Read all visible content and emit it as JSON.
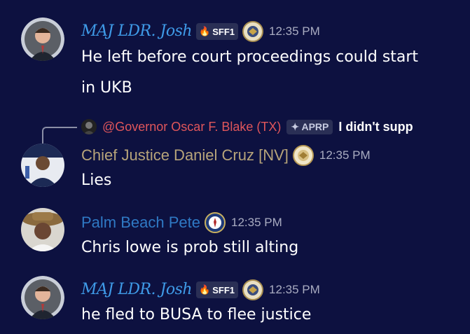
{
  "colors": {
    "background": "#0d1140",
    "maj_ldr_name": "#3f9be8",
    "justice_name": "#b7a47a",
    "pete_name": "#2f79c4",
    "mention": "#e0565b",
    "timestamp": "#a9acc1"
  },
  "messages": [
    {
      "username": "MAJ LDR. Josh",
      "badge": "SFF1",
      "badge_icon": "fire-icon",
      "role_icon": "seal-icon",
      "timestamp": "12:35 PM",
      "lines": [
        "He left before court proceedings could start",
        "in UKB"
      ]
    },
    {
      "reply": {
        "mention": "@Governor Oscar F. Blake (TX)",
        "tag": "APRP",
        "text": "I didn't supp"
      },
      "username": "Chief Justice Daniel Cruz [NV]",
      "role_icon": "seal-icon",
      "timestamp": "12:35 PM",
      "lines": [
        "Lies"
      ]
    },
    {
      "username": "Palm Beach Pete",
      "role_icon": "cia-seal-icon",
      "timestamp": "12:35 PM",
      "lines": [
        "Chris lowe is prob still alting"
      ]
    },
    {
      "username": "MAJ LDR. Josh",
      "badge": "SFF1",
      "badge_icon": "fire-icon",
      "role_icon": "seal-icon",
      "timestamp": "12:35 PM",
      "lines": [
        "he fled to BUSA to flee justice"
      ]
    }
  ]
}
